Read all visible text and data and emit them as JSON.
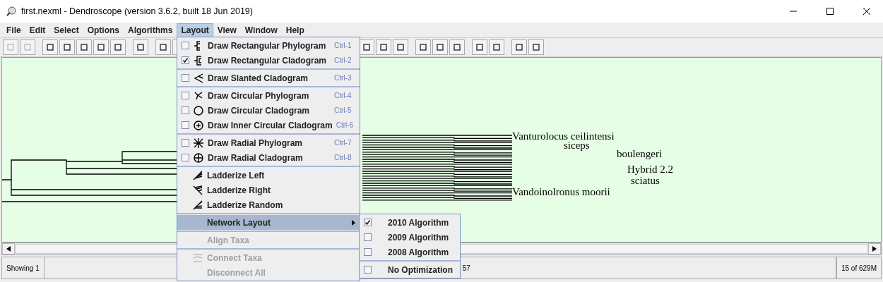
{
  "window": {
    "title": "first.nexml - Dendroscope (version 3.6.2, built 18 Jun 2019)"
  },
  "menubar": [
    {
      "label": "File",
      "selected": false
    },
    {
      "label": "Edit",
      "selected": false
    },
    {
      "label": "Select",
      "selected": false
    },
    {
      "label": "Options",
      "selected": false
    },
    {
      "label": "Algorithms",
      "selected": false
    },
    {
      "label": "Layout",
      "selected": true
    },
    {
      "label": "View",
      "selected": false
    },
    {
      "label": "Window",
      "selected": false
    },
    {
      "label": "Help",
      "selected": false
    }
  ],
  "layout_menu": [
    [
      {
        "kind": "check",
        "label": "Draw Rectangular Phylogram",
        "shortcut": "Ctrl-1",
        "checked": false
      },
      {
        "kind": "check",
        "label": "Draw Rectangular Cladogram",
        "shortcut": "Ctrl-2",
        "checked": true
      }
    ],
    [
      {
        "kind": "check",
        "label": "Draw Slanted Cladogram",
        "shortcut": "Ctrl-3",
        "checked": false
      }
    ],
    [
      {
        "kind": "check",
        "label": "Draw Circular Phylogram",
        "shortcut": "Ctrl-4",
        "checked": false
      },
      {
        "kind": "check",
        "label": "Draw Circular Cladogram",
        "shortcut": "Ctrl-5",
        "checked": false
      },
      {
        "kind": "check",
        "label": "Draw Inner Circular Cladogram",
        "shortcut": "Ctrl-6",
        "checked": false
      }
    ],
    [
      {
        "kind": "check",
        "label": "Draw Radial Phylogram",
        "shortcut": "Ctrl-7",
        "checked": false
      },
      {
        "kind": "check",
        "label": "Draw Radial Cladogram",
        "shortcut": "Ctrl-8",
        "checked": false
      }
    ],
    [
      {
        "kind": "plain",
        "label": "Ladderize Left",
        "disabled": false
      },
      {
        "kind": "plain",
        "label": "Ladderize Right",
        "disabled": false
      },
      {
        "kind": "plain",
        "label": "Ladderize Random",
        "disabled": false
      }
    ],
    [
      {
        "kind": "submenu",
        "label": "Network Layout",
        "selected": true
      }
    ],
    [
      {
        "kind": "plain",
        "label": "Align Taxa",
        "disabled": true
      }
    ],
    [
      {
        "kind": "plain",
        "label": "Connect Taxa",
        "disabled": true
      },
      {
        "kind": "plain",
        "label": "Disconnect All",
        "disabled": true
      }
    ]
  ],
  "network_submenu": [
    [
      {
        "label": "2010 Algorithm",
        "checked": true
      },
      {
        "label": "2009 Algorithm",
        "checked": false
      },
      {
        "label": "2008 Algorithm",
        "checked": false
      }
    ],
    [
      {
        "label": "No Optimization",
        "checked": false
      }
    ]
  ],
  "taxa": [
    "Vanturolocus ceilintensi",
    "siceps",
    "boulengeri",
    "Hybrid 2.2",
    "sciatus",
    "Vandoinolronus moorii"
  ],
  "status_bar": {
    "left": "Showing 1",
    "middle": "57",
    "right": "15 of 629M"
  }
}
